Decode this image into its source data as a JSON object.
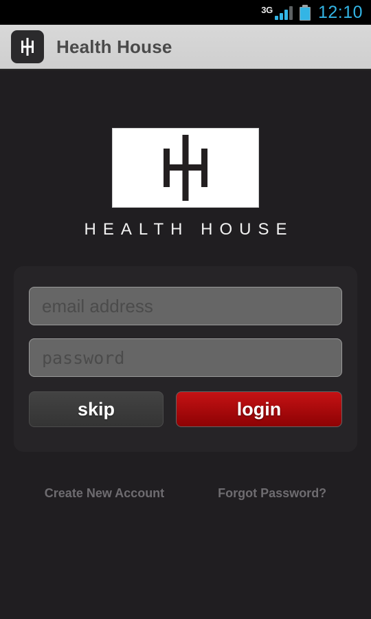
{
  "statusbar": {
    "network_label": "3G",
    "signal_icon": "signal-bars-icon",
    "battery_icon": "battery-charging-icon",
    "clock": "12:10",
    "accent_color": "#33b5e5"
  },
  "actionbar": {
    "app_icon": "health-house-monogram-icon",
    "title": "Health House",
    "background_color": "#d4d4d4",
    "title_color": "#4a4a4a"
  },
  "brand": {
    "logo_icon": "health-house-monogram-logo",
    "wordmark": "HEALTH HOUSE"
  },
  "form": {
    "email": {
      "value": "",
      "placeholder": "email address"
    },
    "password": {
      "value": "",
      "placeholder": "password"
    },
    "skip_label": "skip",
    "login_label": "login",
    "login_color": "#c51214"
  },
  "footer": {
    "create_account_label": "Create New Account",
    "forgot_password_label": "Forgot Password?"
  }
}
